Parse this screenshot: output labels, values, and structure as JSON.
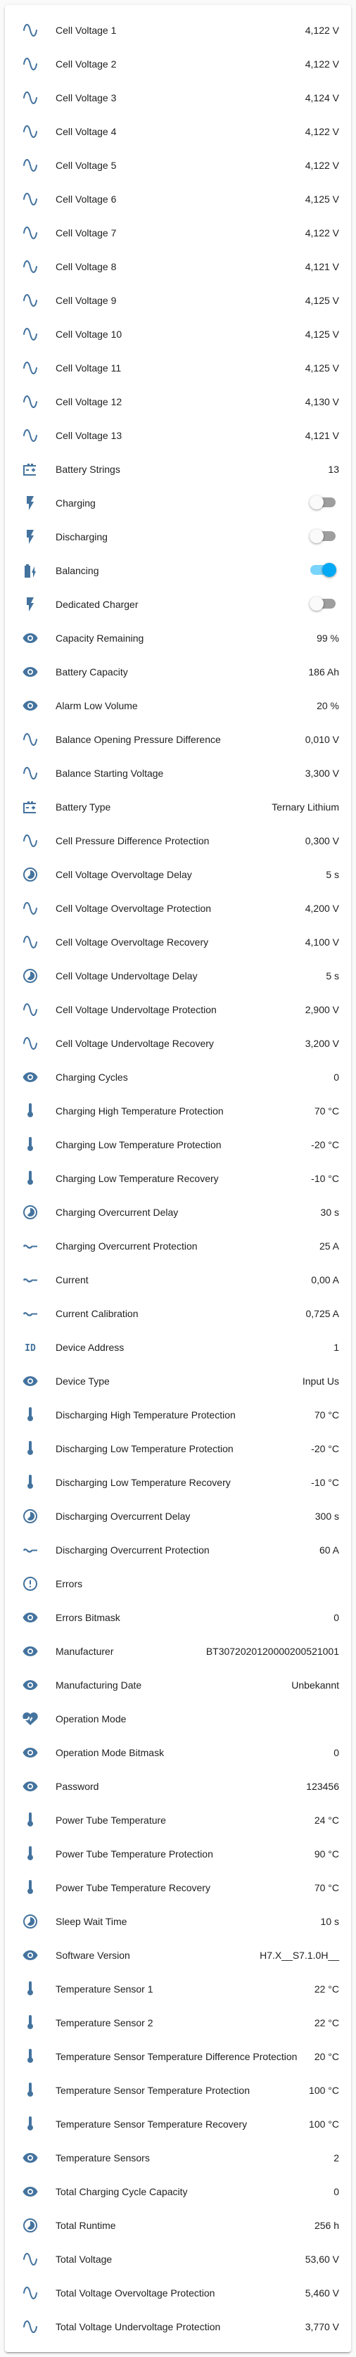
{
  "colors": {
    "icon": "#44739e",
    "text": "#212121",
    "toggle_on": "#03a9f4"
  },
  "rows": [
    {
      "label": "Cell Voltage 1",
      "value": "4,122 V",
      "icon": "sine-wave"
    },
    {
      "label": "Cell Voltage 2",
      "value": "4,122 V",
      "icon": "sine-wave"
    },
    {
      "label": "Cell Voltage 3",
      "value": "4,124 V",
      "icon": "sine-wave"
    },
    {
      "label": "Cell Voltage 4",
      "value": "4,122 V",
      "icon": "sine-wave"
    },
    {
      "label": "Cell Voltage 5",
      "value": "4,122 V",
      "icon": "sine-wave"
    },
    {
      "label": "Cell Voltage 6",
      "value": "4,125 V",
      "icon": "sine-wave"
    },
    {
      "label": "Cell Voltage 7",
      "value": "4,122 V",
      "icon": "sine-wave"
    },
    {
      "label": "Cell Voltage 8",
      "value": "4,121 V",
      "icon": "sine-wave"
    },
    {
      "label": "Cell Voltage 9",
      "value": "4,125 V",
      "icon": "sine-wave"
    },
    {
      "label": "Cell Voltage 10",
      "value": "4,125 V",
      "icon": "sine-wave"
    },
    {
      "label": "Cell Voltage 11",
      "value": "4,125 V",
      "icon": "sine-wave"
    },
    {
      "label": "Cell Voltage 12",
      "value": "4,130 V",
      "icon": "sine-wave"
    },
    {
      "label": "Cell Voltage 13",
      "value": "4,121 V",
      "icon": "sine-wave"
    },
    {
      "label": "Battery Strings",
      "value": "13",
      "icon": "car-battery"
    },
    {
      "label": "Charging",
      "toggle": false,
      "icon": "flash"
    },
    {
      "label": "Discharging",
      "toggle": false,
      "icon": "flash"
    },
    {
      "label": "Balancing",
      "toggle": true,
      "icon": "battery-charging"
    },
    {
      "label": "Dedicated Charger",
      "toggle": false,
      "icon": "flash"
    },
    {
      "label": "Capacity Remaining",
      "value": "99 %",
      "icon": "eye"
    },
    {
      "label": "Battery Capacity",
      "value": "186 Ah",
      "icon": "eye"
    },
    {
      "label": "Alarm Low Volume",
      "value": "20 %",
      "icon": "eye"
    },
    {
      "label": "Balance Opening Pressure Difference",
      "value": "0,010 V",
      "icon": "sine-wave"
    },
    {
      "label": "Balance Starting Voltage",
      "value": "3,300 V",
      "icon": "sine-wave"
    },
    {
      "label": "Battery Type",
      "value": "Ternary Lithium",
      "icon": "car-battery"
    },
    {
      "label": "Cell Pressure Difference Protection",
      "value": "0,300 V",
      "icon": "sine-wave"
    },
    {
      "label": "Cell Voltage Overvoltage Delay",
      "value": "5 s",
      "icon": "timer"
    },
    {
      "label": "Cell Voltage Overvoltage Protection",
      "value": "4,200 V",
      "icon": "sine-wave"
    },
    {
      "label": "Cell Voltage Overvoltage Recovery",
      "value": "4,100 V",
      "icon": "sine-wave"
    },
    {
      "label": "Cell Voltage Undervoltage Delay",
      "value": "5 s",
      "icon": "timer"
    },
    {
      "label": "Cell Voltage Undervoltage Protection",
      "value": "2,900 V",
      "icon": "sine-wave"
    },
    {
      "label": "Cell Voltage Undervoltage Recovery",
      "value": "3,200 V",
      "icon": "sine-wave"
    },
    {
      "label": "Charging Cycles",
      "value": "0",
      "icon": "eye"
    },
    {
      "label": "Charging High Temperature Protection",
      "value": "70 °C",
      "icon": "thermometer"
    },
    {
      "label": "Charging Low Temperature Protection",
      "value": "-20 °C",
      "icon": "thermometer"
    },
    {
      "label": "Charging Low Temperature Recovery",
      "value": "-10 °C",
      "icon": "thermometer"
    },
    {
      "label": "Charging Overcurrent Delay",
      "value": "30 s",
      "icon": "timer"
    },
    {
      "label": "Charging Overcurrent Protection",
      "value": "25 A",
      "icon": "current-ac"
    },
    {
      "label": "Current",
      "value": "0,00 A",
      "icon": "current-ac"
    },
    {
      "label": "Current Calibration",
      "value": "0,725 A",
      "icon": "current-ac"
    },
    {
      "label": "Device Address",
      "value": "1",
      "icon": "identifier"
    },
    {
      "label": "Device Type",
      "value": "Input Us",
      "icon": "eye"
    },
    {
      "label": "Discharging High Temperature Protection",
      "value": "70 °C",
      "icon": "thermometer"
    },
    {
      "label": "Discharging Low Temperature Protection",
      "value": "-20 °C",
      "icon": "thermometer"
    },
    {
      "label": "Discharging Low Temperature Recovery",
      "value": "-10 °C",
      "icon": "thermometer"
    },
    {
      "label": "Discharging Overcurrent Delay",
      "value": "300 s",
      "icon": "timer"
    },
    {
      "label": "Discharging Overcurrent Protection",
      "value": "60 A",
      "icon": "current-ac"
    },
    {
      "label": "Errors",
      "value": "",
      "icon": "alert-circle"
    },
    {
      "label": "Errors Bitmask",
      "value": "0",
      "icon": "eye"
    },
    {
      "label": "Manufacturer",
      "value": "BT3072020120000200521001",
      "icon": "eye"
    },
    {
      "label": "Manufacturing Date",
      "value": "Unbekannt",
      "icon": "eye"
    },
    {
      "label": "Operation Mode",
      "value": "",
      "icon": "heart-pulse"
    },
    {
      "label": "Operation Mode Bitmask",
      "value": "0",
      "icon": "eye"
    },
    {
      "label": "Password",
      "value": "123456",
      "icon": "eye"
    },
    {
      "label": "Power Tube Temperature",
      "value": "24 °C",
      "icon": "thermometer"
    },
    {
      "label": "Power Tube Temperature Protection",
      "value": "90 °C",
      "icon": "thermometer"
    },
    {
      "label": "Power Tube Temperature Recovery",
      "value": "70 °C",
      "icon": "thermometer"
    },
    {
      "label": "Sleep Wait Time",
      "value": "10 s",
      "icon": "timer"
    },
    {
      "label": "Software Version",
      "value": "H7.X__S7.1.0H__",
      "icon": "eye"
    },
    {
      "label": "Temperature Sensor 1",
      "value": "22 °C",
      "icon": "thermometer"
    },
    {
      "label": "Temperature Sensor 2",
      "value": "22 °C",
      "icon": "thermometer"
    },
    {
      "label": "Temperature Sensor Temperature Difference Protection",
      "value": "20 °C",
      "icon": "thermometer"
    },
    {
      "label": "Temperature Sensor Temperature Protection",
      "value": "100 °C",
      "icon": "thermometer"
    },
    {
      "label": "Temperature Sensor Temperature Recovery",
      "value": "100 °C",
      "icon": "thermometer"
    },
    {
      "label": "Temperature Sensors",
      "value": "2",
      "icon": "eye"
    },
    {
      "label": "Total Charging Cycle Capacity",
      "value": "0",
      "icon": "eye"
    },
    {
      "label": "Total Runtime",
      "value": "256 h",
      "icon": "timer"
    },
    {
      "label": "Total Voltage",
      "value": "53,60 V",
      "icon": "sine-wave"
    },
    {
      "label": "Total Voltage Overvoltage Protection",
      "value": "5,460 V",
      "icon": "sine-wave"
    },
    {
      "label": "Total Voltage Undervoltage Protection",
      "value": "3,770 V",
      "icon": "sine-wave"
    }
  ]
}
